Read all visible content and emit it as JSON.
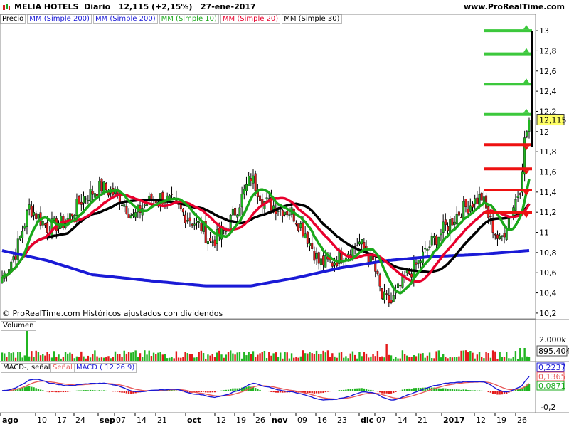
{
  "header": {
    "symbol": "MELIA HOTELS",
    "period": "Diario",
    "last": "12,115 (+2,15%)",
    "date": "27-ene-2017",
    "brand": "www.ProRealTime.com"
  },
  "legend": [
    {
      "label": "Precio",
      "color": "#000000"
    },
    {
      "label": "MM (Simple 200)",
      "color": "#1a1ad6"
    },
    {
      "label": "MM (Simple 200)",
      "color": "#1a1ad6"
    },
    {
      "label": "MM (Simple 10)",
      "color": "#1aa81a"
    },
    {
      "label": "MM (Simple 20)",
      "color": "#e8002d"
    },
    {
      "label": "MM (Simple 30)",
      "color": "#000000"
    }
  ],
  "copyright": "© ProRealTime.com Históricos ajustados con dividendos",
  "volume_label": "Volumen",
  "macd_labels": {
    "macd_signal": "MACD-, señal",
    "signal": "Señal",
    "macd": "MACD ( 12 26 9)"
  },
  "chart_data": [
    {
      "type": "candlestick",
      "title": "MELIA HOTELS Diario",
      "last_price": 12.115,
      "last_price_label": "12,115",
      "ylim": [
        10.15,
        13.05
      ],
      "y_ticks": [
        10.2,
        10.4,
        10.6,
        10.8,
        11,
        11.2,
        11.4,
        11.6,
        11.8,
        12,
        12.2,
        12.4,
        12.6,
        12.8,
        13
      ],
      "y_tick_labels": [
        "10,2",
        "10,4",
        "10,6",
        "10,8",
        "11",
        "11,2",
        "11,4",
        "11,6",
        "11,8",
        "12",
        "12,2",
        "12,4",
        "12,6",
        "12,8",
        "13"
      ],
      "x_labels": [
        "ago",
        "10",
        "17",
        "24",
        "sep",
        "07",
        "14",
        "21",
        "oct",
        "12",
        "19",
        "26",
        "nov",
        "09",
        "16",
        "23",
        "dic",
        "07",
        "14",
        "21",
        "2017",
        "12",
        "19",
        "26"
      ],
      "target_levels_green": [
        13.0,
        12.77,
        12.47,
        12.17
      ],
      "stop_levels_red": [
        11.87,
        11.63,
        11.42,
        11.2
      ],
      "close_anchors": [
        [
          0,
          10.55
        ],
        [
          6,
          10.8
        ],
        [
          12,
          11.25
        ],
        [
          20,
          11.05
        ],
        [
          28,
          11.1
        ],
        [
          36,
          11.35
        ],
        [
          44,
          11.45
        ],
        [
          52,
          11.35
        ],
        [
          58,
          11.15
        ],
        [
          64,
          11.3
        ],
        [
          70,
          11.35
        ],
        [
          75,
          11.3
        ],
        [
          82,
          11.15
        ],
        [
          88,
          11.05
        ],
        [
          92,
          10.9
        ],
        [
          98,
          11.0
        ],
        [
          104,
          11.25
        ],
        [
          110,
          11.55
        ],
        [
          116,
          11.3
        ],
        [
          122,
          11.25
        ],
        [
          128,
          11.2
        ],
        [
          134,
          11.0
        ],
        [
          140,
          10.7
        ],
        [
          146,
          10.7
        ],
        [
          152,
          10.8
        ],
        [
          158,
          10.9
        ],
        [
          164,
          10.7
        ],
        [
          168,
          10.35
        ],
        [
          172,
          10.3
        ],
        [
          178,
          10.55
        ],
        [
          184,
          10.7
        ],
        [
          190,
          10.9
        ],
        [
          196,
          11.05
        ],
        [
          202,
          11.2
        ],
        [
          208,
          11.3
        ],
        [
          212,
          11.35
        ],
        [
          216,
          11.1
        ],
        [
          220,
          10.9
        ],
        [
          225,
          11.2
        ],
        [
          229,
          11.45
        ],
        [
          231,
          11.9
        ],
        [
          233,
          12.115
        ]
      ],
      "series": [
        {
          "name": "MM (Simple 10)",
          "color": "#1aa81a"
        },
        {
          "name": "MM (Simple 20)",
          "color": "#e8002d"
        },
        {
          "name": "MM (Simple 30)",
          "color": "#000000"
        },
        {
          "name": "MM (Simple 200)",
          "color": "#1a1ad6",
          "anchors": [
            [
              0,
              10.82
            ],
            [
              20,
              10.72
            ],
            [
              40,
              10.58
            ],
            [
              70,
              10.51
            ],
            [
              90,
              10.47
            ],
            [
              110,
              10.47
            ],
            [
              130,
              10.55
            ],
            [
              150,
              10.65
            ],
            [
              170,
              10.72
            ],
            [
              190,
              10.76
            ],
            [
              210,
              10.78
            ],
            [
              233,
              10.82
            ]
          ]
        }
      ]
    },
    {
      "type": "bar",
      "title": "Volumen",
      "value_label": "895.404",
      "value": 895404,
      "y_tick_labels": [
        "2.000k"
      ]
    },
    {
      "type": "line",
      "title": "MACD ( 12 26 9)",
      "series": [
        {
          "name": "MACD",
          "color": "#1a1ad6"
        },
        {
          "name": "Señal",
          "color": "#e85a5a"
        }
      ],
      "value_labels": [
        "0,2237",
        "0,1365",
        "0,0871"
      ],
      "y_tick_labels": [
        "-0,2"
      ]
    }
  ]
}
